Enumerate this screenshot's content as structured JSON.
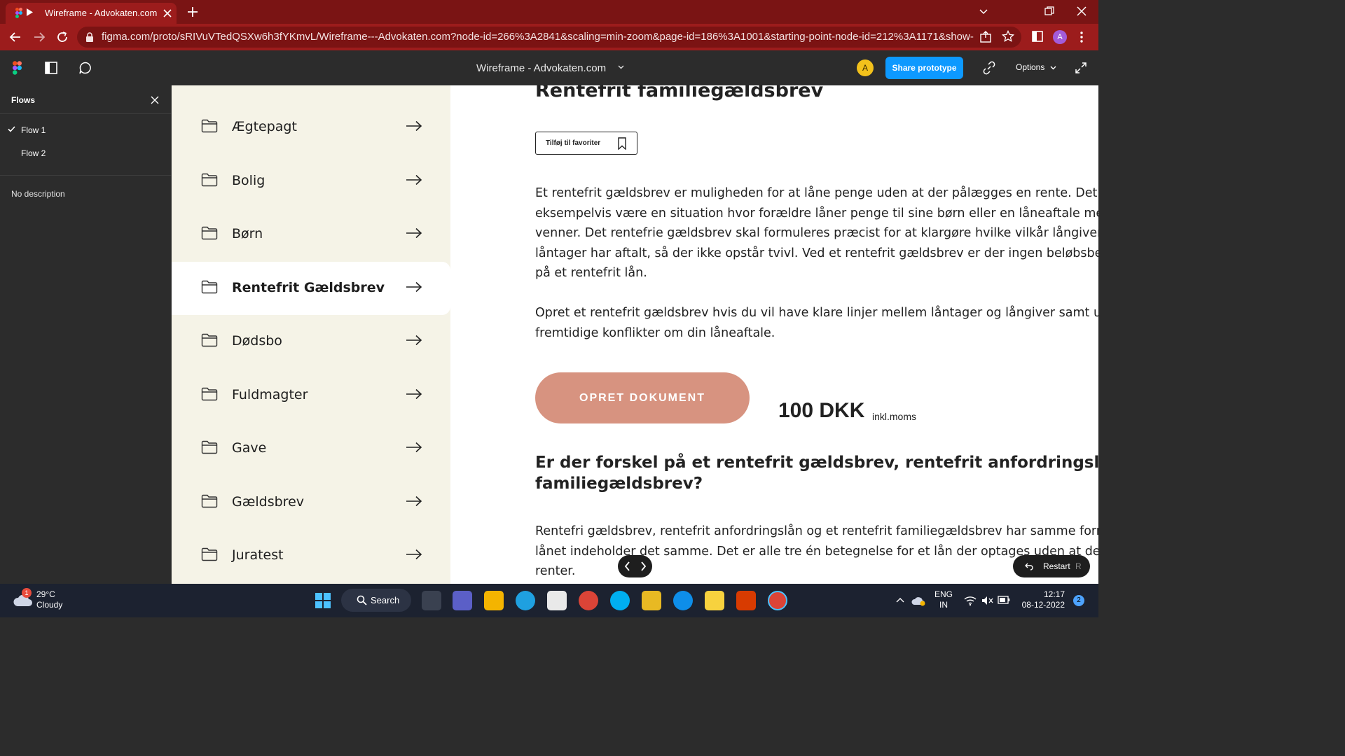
{
  "browser": {
    "tab_title": "Wireframe - Advokaten.com",
    "url": "figma.com/proto/sRIVuVTedQSXw6h3fYKmvL/Wireframe---Advokaten.com?node-id=266%3A2841&scaling=min-zoom&page-id=186%3A1001&starting-point-node-id=212%3A1171&show-prot...",
    "profile_initial": "A"
  },
  "figma": {
    "file_title": "Wireframe - Advokaten.com",
    "user_initial": "A",
    "share_label": "Share prototype",
    "options_label": "Options"
  },
  "flows": {
    "header": "Flows",
    "items": [
      {
        "label": "Flow 1",
        "selected": true
      },
      {
        "label": "Flow 2",
        "selected": false
      }
    ],
    "description": "No description"
  },
  "categories": [
    {
      "label": "Ægtepagt",
      "active": false
    },
    {
      "label": "Bolig",
      "active": false
    },
    {
      "label": "Børn",
      "active": false
    },
    {
      "label": "Rentefrit Gældsbrev",
      "active": true
    },
    {
      "label": "Dødsbo",
      "active": false
    },
    {
      "label": "Fuldmagter",
      "active": false
    },
    {
      "label": "Gave",
      "active": false
    },
    {
      "label": "Gældsbrev",
      "active": false
    },
    {
      "label": "Juratest",
      "active": false
    }
  ],
  "content": {
    "heading": "Rentefrit familiegældsbrev",
    "favorite_label": "Tilføj til favoriter",
    "para1": [
      "Et rentefrit gældsbrev er muligheden for at låne penge uden at der pålægges en rente. Det kan",
      "eksempelvis være en situation hvor forældre låner penge til sine børn eller en låneaftale mellem",
      "venner. Det rentefrie gældsbrev skal formuleres præcist for at klargøre hvilke vilkår långiver og",
      "låntager har aftalt, så der ikke opstår tvivl. Ved et rentefrit gældsbrev er der ingen beløbsbegræn",
      "på et rentefrit lån."
    ],
    "para2": [
      "Opret et rentefrit gældsbrev hvis du vil have klare linjer mellem låntager og långiver samt undgå",
      "fremtidige konflikter om din låneaftale."
    ],
    "cta_label": "OPRET DOKUMENT",
    "price": "100 DKK",
    "price_note": "inkl.moms",
    "heading2": [
      "Er der forskel på et rentefrit gældsbrev, rentefrit anfordringslån og et ren",
      "familiegældsbrev?"
    ],
    "para3": [
      "Rentefri gældsbrev, rentefrit anfordringslån og et rentefrit familiegældsbrev har samme formål o",
      "lånet indeholder det samme. Det er alle tre én betegnelse for et lån der optages uden at der påla",
      "renter."
    ]
  },
  "prototype_controls": {
    "restart_label": "Restart",
    "restart_key": "R"
  },
  "taskbar": {
    "weather_temp": "29°C",
    "weather_desc": "Cloudy",
    "weather_badge": "1",
    "search_label": "Search",
    "lang1": "ENG",
    "lang2": "IN",
    "time": "12:17",
    "date": "08-12-2022",
    "notifications": "2"
  },
  "colors": {
    "browser_frame": "#7a1414",
    "figma_bg": "#2c2c2c",
    "share_blue": "#0d99ff",
    "category_panel": "#f5f3e7",
    "cta": "#d79380"
  }
}
